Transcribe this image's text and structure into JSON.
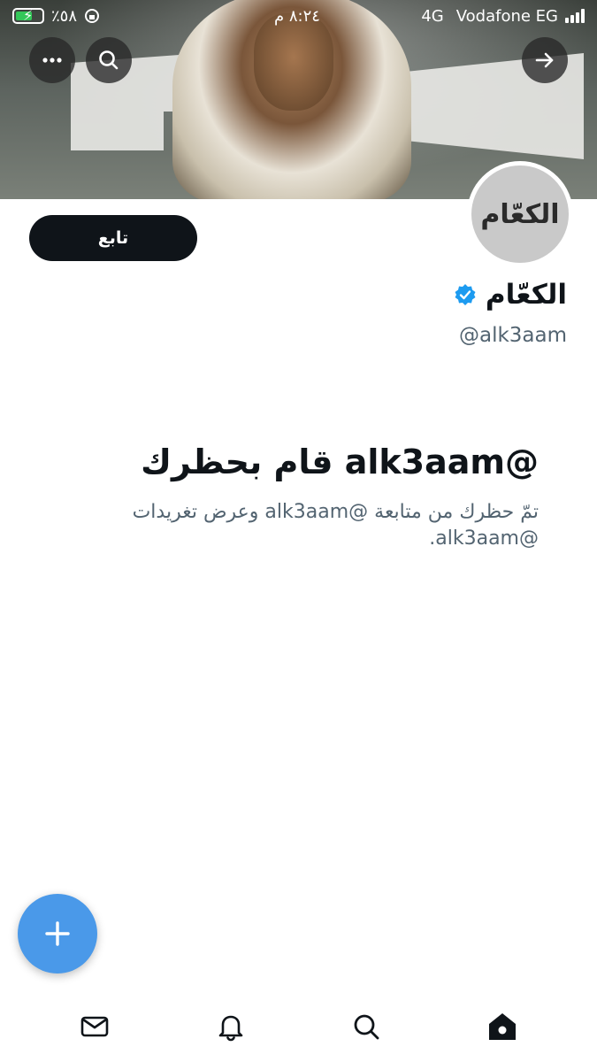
{
  "status_bar": {
    "battery_percent": "٪٥٨",
    "time": "٨:٢٤ م",
    "network": "4G",
    "carrier": "Vodafone EG"
  },
  "profile": {
    "display_name": "الكعّام",
    "handle": "@alk3aam",
    "avatar_text": "الكعّام",
    "verified": true,
    "follow_label": "تابع"
  },
  "blocked": {
    "title": "@alk3aam قام بحظرك",
    "description": "تمّ حظرك من متابعة @alk3aam وعرض تغريدات @alk3aam."
  },
  "icons": {
    "back": "arrow-right-icon",
    "search": "search-icon",
    "more": "more-dots-icon",
    "compose": "plus-icon",
    "nav": [
      "home-icon",
      "search-icon",
      "bell-icon",
      "mail-icon"
    ]
  },
  "colors": {
    "accent": "#4a99e9",
    "verified": "#1d9bf0",
    "text_primary": "#0f1419",
    "text_secondary": "#536471"
  }
}
